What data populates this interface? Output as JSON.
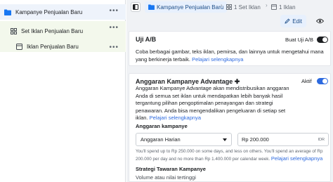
{
  "tree": {
    "campaign": {
      "label": "Kampanye Penjualan Baru",
      "more": "•••"
    },
    "adset": {
      "label": "Set Iklan Penjualan Baru",
      "more": "•••"
    },
    "ad": {
      "label": "Iklan Penjualan Baru",
      "more": "•••"
    }
  },
  "breadcrumb": {
    "campaign": "Kampanye Penjualan Baru",
    "adset": "1 Set Iklan",
    "ad": "1 Iklan"
  },
  "actions": {
    "edit": "Edit",
    "view": ""
  },
  "ab_test": {
    "title": "Uji A/B",
    "toggle_label": "Buat Uji A/B",
    "toggle_on": false,
    "description": "Coba berbagai gambar, teks iklan, pemirsa, dan lainnya untuk mengetahui mana yang berkinerja terbaik.",
    "link": "Pelajari selengkapnya"
  },
  "advantage": {
    "title": "Anggaran Kampanye Advantage",
    "title_icon": "✚",
    "toggle_label": "Aktif",
    "toggle_on": true,
    "description": "Anggaran Kampanye Advantage akan mendistribusikan anggaran Anda di semua set iklan untuk mendapatkan lebih banyak hasil tergantung pilihan pengoptimalan penayangan dan strategi penawaran. Anda bisa mengendalikan pengeluaran di setiap set iklan.",
    "link": "Pelajari selengkapnya",
    "budget_heading": "Anggaran kampanye",
    "budget_type": "Anggaran Harian",
    "budget_value": "Rp 200.000",
    "currency": "IDR",
    "note": "You'll spend up to Rp 250.000 on some days, and less on others. You'll spend an average of Rp 200.000 per day and no more than Rp 1.400.000 per calendar week.",
    "note_link": "Pelajari selengkapnya",
    "bid_heading": "Strategi Tawaran Kampanye",
    "bid_value": "Volume atau nilai tertinggi"
  },
  "colors": {
    "accent": "#2d6adf",
    "folder": "#1877f2",
    "selected_bg": "#eef3fb"
  }
}
